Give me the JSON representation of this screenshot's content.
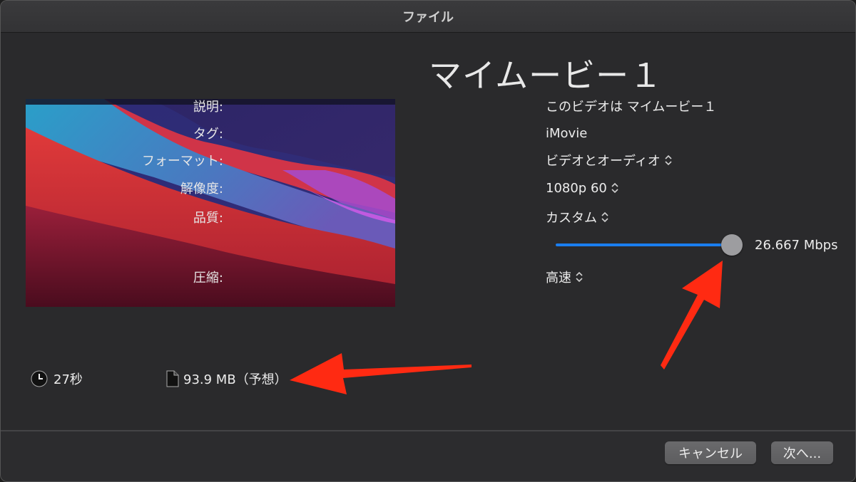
{
  "window": {
    "title": "ファイル"
  },
  "project": {
    "title": "マイムービー１"
  },
  "fields": {
    "description": {
      "label": "説明:",
      "value": "このビデオは マイムービー１"
    },
    "tags": {
      "label": "タグ:",
      "value": "iMovie"
    },
    "format": {
      "label": "フォーマット:",
      "value": "ビデオとオーディオ"
    },
    "resolution": {
      "label": "解像度:",
      "value": "1080p 60"
    },
    "quality": {
      "label": "品質:",
      "value": "カスタム"
    },
    "bitrate": {
      "value": "26.667 Mbps",
      "slider_fraction": 1.0
    },
    "compression": {
      "label": "圧縮:",
      "value": "高速"
    }
  },
  "stats": {
    "duration": "27秒",
    "filesize": "93.9 MB（予想）"
  },
  "buttons": {
    "cancel": "キャンセル",
    "next": "次へ..."
  },
  "colors": {
    "slider_track": "#1a7ef0",
    "annotation_arrow": "#ff2a12"
  }
}
